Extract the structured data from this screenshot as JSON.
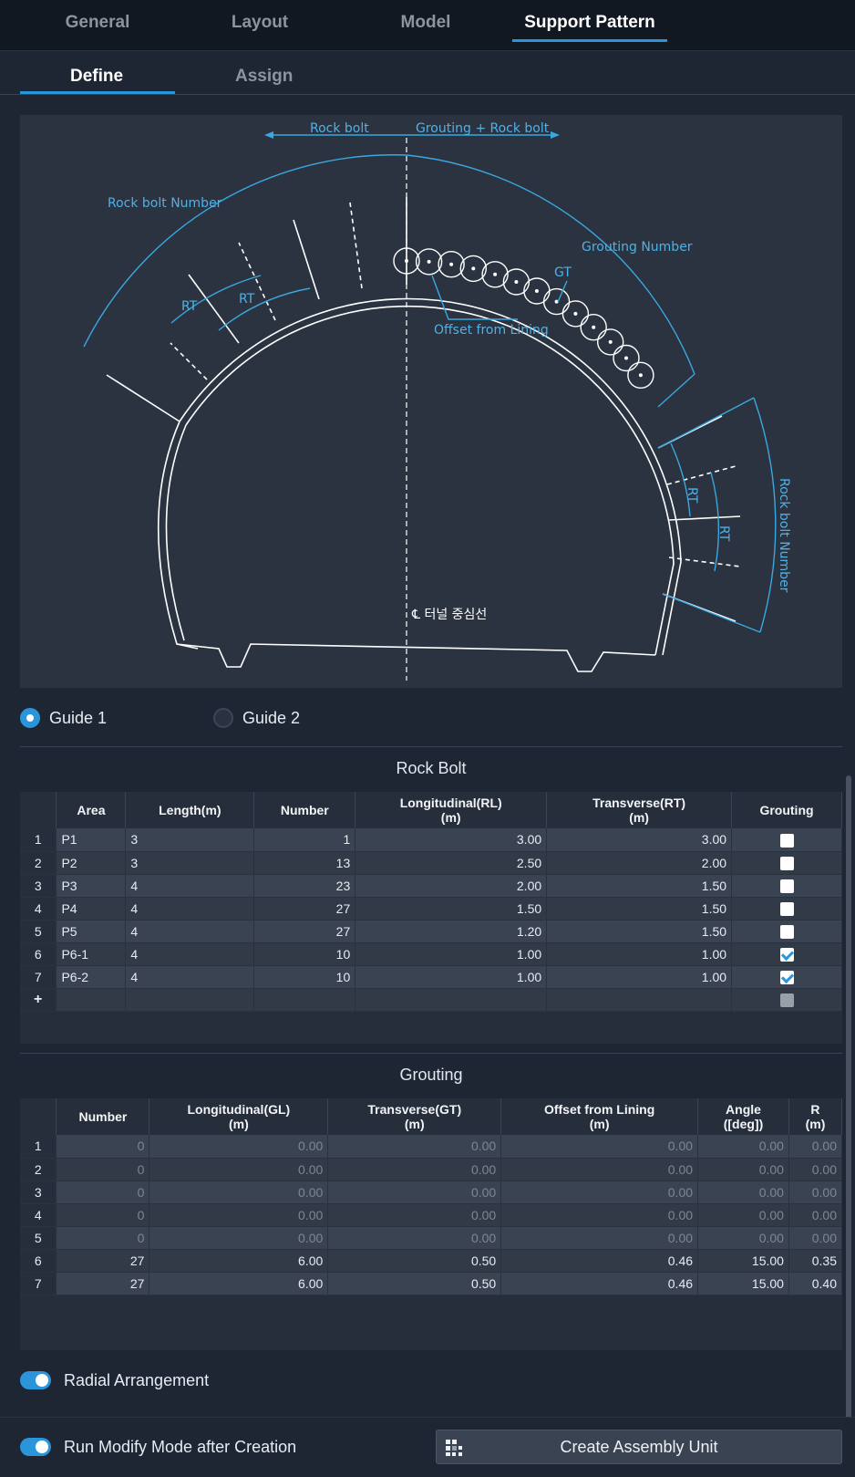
{
  "tabs": [
    {
      "label": "General"
    },
    {
      "label": "Layout"
    },
    {
      "label": "Model"
    },
    {
      "label": "Support Pattern"
    }
  ],
  "subtabs": [
    {
      "label": "Define"
    },
    {
      "label": "Assign"
    }
  ],
  "diagram": {
    "rock_bolt": "Rock bolt",
    "grouting_rock_bolt": "Grouting + Rock bolt",
    "rock_bolt_number": "Rock bolt Number",
    "grouting_number": "Grouting Number",
    "gt": "GT",
    "rt": "RT",
    "offset_from_lining": "Offset from Lining",
    "centerline": "℄ 터널 중심선"
  },
  "guides": [
    {
      "label": "Guide 1",
      "selected": true
    },
    {
      "label": "Guide 2",
      "selected": false
    }
  ],
  "rock_bolt": {
    "title": "Rock Bolt",
    "headers": [
      "Area",
      "Length(m)",
      "Number",
      "Longitudinal(RL)\n(m)",
      "Transverse(RT)\n(m)",
      "Grouting"
    ],
    "rows": [
      {
        "idx": "1",
        "area": "P1",
        "length": "3",
        "number": "1",
        "rl": "3.00",
        "rt": "3.00",
        "grouting": false
      },
      {
        "idx": "2",
        "area": "P2",
        "length": "3",
        "number": "13",
        "rl": "2.50",
        "rt": "2.00",
        "grouting": false
      },
      {
        "idx": "3",
        "area": "P3",
        "length": "4",
        "number": "23",
        "rl": "2.00",
        "rt": "1.50",
        "grouting": false
      },
      {
        "idx": "4",
        "area": "P4",
        "length": "4",
        "number": "27",
        "rl": "1.50",
        "rt": "1.50",
        "grouting": false
      },
      {
        "idx": "5",
        "area": "P5",
        "length": "4",
        "number": "27",
        "rl": "1.20",
        "rt": "1.50",
        "grouting": false
      },
      {
        "idx": "6",
        "area": "P6-1",
        "length": "4",
        "number": "10",
        "rl": "1.00",
        "rt": "1.00",
        "grouting": true
      },
      {
        "idx": "7",
        "area": "P6-2",
        "length": "4",
        "number": "10",
        "rl": "1.00",
        "rt": "1.00",
        "grouting": true
      }
    ],
    "add_row": "+"
  },
  "grouting": {
    "title": "Grouting",
    "headers": [
      "Number",
      "Longitudinal(GL)\n(m)",
      "Transverse(GT)\n(m)",
      "Offset from Lining\n(m)",
      "Angle\n([deg])",
      "R\n(m)"
    ],
    "rows": [
      {
        "idx": "1",
        "number": "0",
        "gl": "0.00",
        "gt": "0.00",
        "offset": "0.00",
        "angle": "0.00",
        "r": "0.00",
        "disabled": true
      },
      {
        "idx": "2",
        "number": "0",
        "gl": "0.00",
        "gt": "0.00",
        "offset": "0.00",
        "angle": "0.00",
        "r": "0.00",
        "disabled": true
      },
      {
        "idx": "3",
        "number": "0",
        "gl": "0.00",
        "gt": "0.00",
        "offset": "0.00",
        "angle": "0.00",
        "r": "0.00",
        "disabled": true
      },
      {
        "idx": "4",
        "number": "0",
        "gl": "0.00",
        "gt": "0.00",
        "offset": "0.00",
        "angle": "0.00",
        "r": "0.00",
        "disabled": true
      },
      {
        "idx": "5",
        "number": "0",
        "gl": "0.00",
        "gt": "0.00",
        "offset": "0.00",
        "angle": "0.00",
        "r": "0.00",
        "disabled": true
      },
      {
        "idx": "6",
        "number": "27",
        "gl": "6.00",
        "gt": "0.50",
        "offset": "0.46",
        "angle": "15.00",
        "r": "0.35",
        "disabled": false
      },
      {
        "idx": "7",
        "number": "27",
        "gl": "6.00",
        "gt": "0.50",
        "offset": "0.46",
        "angle": "15.00",
        "r": "0.40",
        "disabled": false
      }
    ]
  },
  "radial_arrangement": {
    "label": "Radial Arrangement",
    "on": true
  },
  "run_modify": {
    "label": "Run Modify Mode after Creation",
    "on": true
  },
  "create_button": {
    "label": "Create Assembly Unit"
  },
  "colors": {
    "accent": "#2b95dc",
    "diagram_line": "#ffffff",
    "diagram_dim": "#3aa7e0"
  }
}
